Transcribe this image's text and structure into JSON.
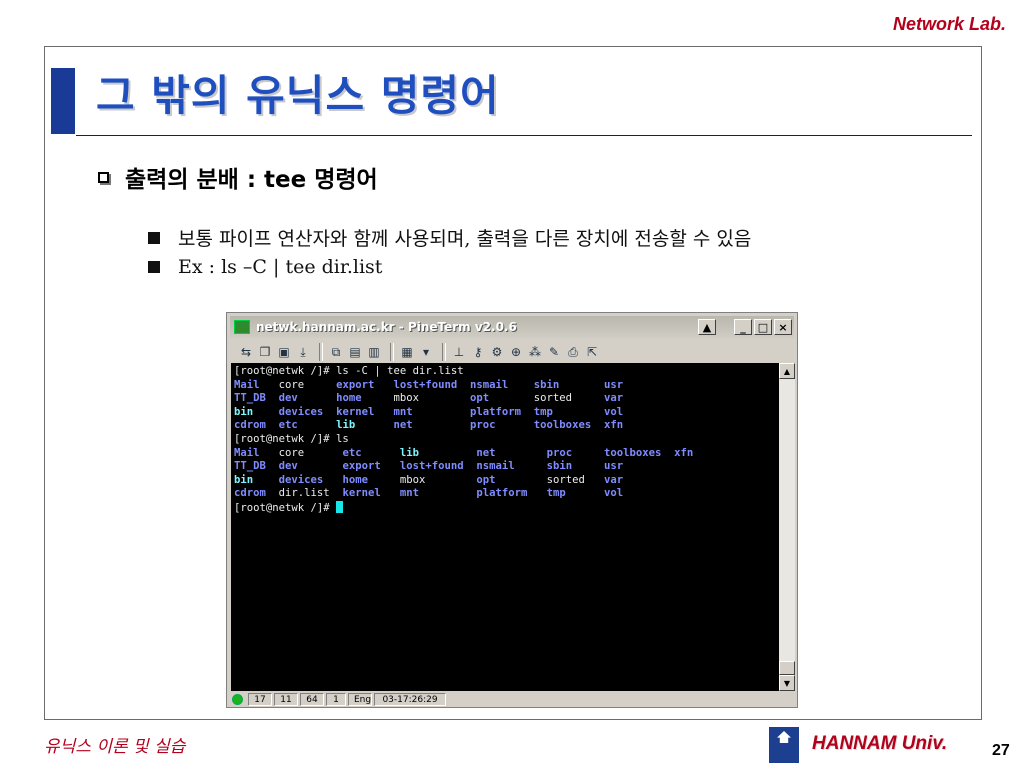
{
  "header": {
    "lab": "Network Lab."
  },
  "slide": {
    "title": "그 밖의 유닉스 명령어",
    "bullet": "출력의 분배 : tee 명령어",
    "subs": [
      "보통 파이프 연산자와 함께 사용되며, 출력을 다른 장치에 전송할 수 있음",
      "Ex : ls –C | tee dir.list"
    ]
  },
  "window": {
    "title": "netwk.hannam.ac.kr - PineTerm v2.0.6",
    "buttons": {
      "arrow": "▲",
      "minimize": "_",
      "maximize": "□",
      "close": "×"
    }
  },
  "terminal": {
    "lines": [
      [
        {
          "t": "[root@netwk /]# ls -C | tee dir.list",
          "c": "white"
        }
      ],
      [
        {
          "t": "Mail   ",
          "c": "blue"
        },
        {
          "t": "core     ",
          "c": "white"
        },
        {
          "t": "export   ",
          "c": "blue"
        },
        {
          "t": "lost+found  ",
          "c": "blue"
        },
        {
          "t": "nsmail    ",
          "c": "blue"
        },
        {
          "t": "sbin       ",
          "c": "blue"
        },
        {
          "t": "usr",
          "c": "blue"
        }
      ],
      [
        {
          "t": "TT_DB  ",
          "c": "blue"
        },
        {
          "t": "dev      ",
          "c": "blue"
        },
        {
          "t": "home     ",
          "c": "blue"
        },
        {
          "t": "mbox        ",
          "c": "white"
        },
        {
          "t": "opt       ",
          "c": "blue"
        },
        {
          "t": "sorted     ",
          "c": "white"
        },
        {
          "t": "var",
          "c": "blue"
        }
      ],
      [
        {
          "t": "bin    ",
          "c": "cyan"
        },
        {
          "t": "devices  ",
          "c": "blue"
        },
        {
          "t": "kernel   ",
          "c": "blue"
        },
        {
          "t": "mnt         ",
          "c": "blue"
        },
        {
          "t": "platform  ",
          "c": "blue"
        },
        {
          "t": "tmp        ",
          "c": "blue"
        },
        {
          "t": "vol",
          "c": "blue"
        }
      ],
      [
        {
          "t": "cdrom  ",
          "c": "blue"
        },
        {
          "t": "etc      ",
          "c": "blue"
        },
        {
          "t": "lib      ",
          "c": "cyan"
        },
        {
          "t": "net         ",
          "c": "blue"
        },
        {
          "t": "proc      ",
          "c": "blue"
        },
        {
          "t": "toolboxes  ",
          "c": "blue"
        },
        {
          "t": "xfn",
          "c": "blue"
        }
      ],
      [
        {
          "t": "[root@netwk /]# ls",
          "c": "white"
        }
      ],
      [
        {
          "t": "Mail   ",
          "c": "blue"
        },
        {
          "t": "core      ",
          "c": "white"
        },
        {
          "t": "etc      ",
          "c": "blue"
        },
        {
          "t": "lib         ",
          "c": "cyan"
        },
        {
          "t": "net        ",
          "c": "blue"
        },
        {
          "t": "proc     ",
          "c": "blue"
        },
        {
          "t": "toolboxes  ",
          "c": "blue"
        },
        {
          "t": "xfn",
          "c": "blue"
        }
      ],
      [
        {
          "t": "TT_DB  ",
          "c": "blue"
        },
        {
          "t": "dev       ",
          "c": "blue"
        },
        {
          "t": "export   ",
          "c": "blue"
        },
        {
          "t": "lost+found  ",
          "c": "blue"
        },
        {
          "t": "nsmail     ",
          "c": "blue"
        },
        {
          "t": "sbin     ",
          "c": "blue"
        },
        {
          "t": "usr",
          "c": "blue"
        }
      ],
      [
        {
          "t": "bin    ",
          "c": "cyan"
        },
        {
          "t": "devices   ",
          "c": "blue"
        },
        {
          "t": "home     ",
          "c": "blue"
        },
        {
          "t": "mbox        ",
          "c": "white"
        },
        {
          "t": "opt        ",
          "c": "blue"
        },
        {
          "t": "sorted   ",
          "c": "white"
        },
        {
          "t": "var",
          "c": "blue"
        }
      ],
      [
        {
          "t": "cdrom  ",
          "c": "blue"
        },
        {
          "t": "dir.list  ",
          "c": "white"
        },
        {
          "t": "kernel   ",
          "c": "blue"
        },
        {
          "t": "mnt         ",
          "c": "blue"
        },
        {
          "t": "platform   ",
          "c": "blue"
        },
        {
          "t": "tmp      ",
          "c": "blue"
        },
        {
          "t": "vol",
          "c": "blue"
        }
      ],
      [
        {
          "t": "[root@netwk /]# ",
          "c": "white"
        }
      ]
    ]
  },
  "status": {
    "cells": [
      "17",
      "11",
      "64",
      "1",
      "Eng",
      "03-17:26:29"
    ]
  },
  "footer": {
    "left": "유닉스 이론 및 실습",
    "univ": "HANNAM Univ.",
    "page": "27"
  },
  "colors": {
    "title": "#1f4fbf",
    "accent": "#1a3a98",
    "footer": "#b3001b",
    "term_blue": "#7f8cff",
    "term_cyan": "#7cf6ff"
  },
  "icons": {
    "window": "terminal-app-icon",
    "toolbar": [
      "connect-icon",
      "new-session-icon",
      "save-icon",
      "transfer-icon",
      "copy-icon",
      "paste-icon",
      "clipboard-icon",
      "log-icon",
      "dropdown-icon",
      "keyboard-icon",
      "key-icon",
      "settings-icon",
      "zoom-icon",
      "network-icon",
      "script-icon",
      "print-icon",
      "exit-icon"
    ],
    "scroll_up": "scroll-up-icon",
    "scroll_down": "scroll-down-icon",
    "status_led": "connection-led-icon"
  }
}
